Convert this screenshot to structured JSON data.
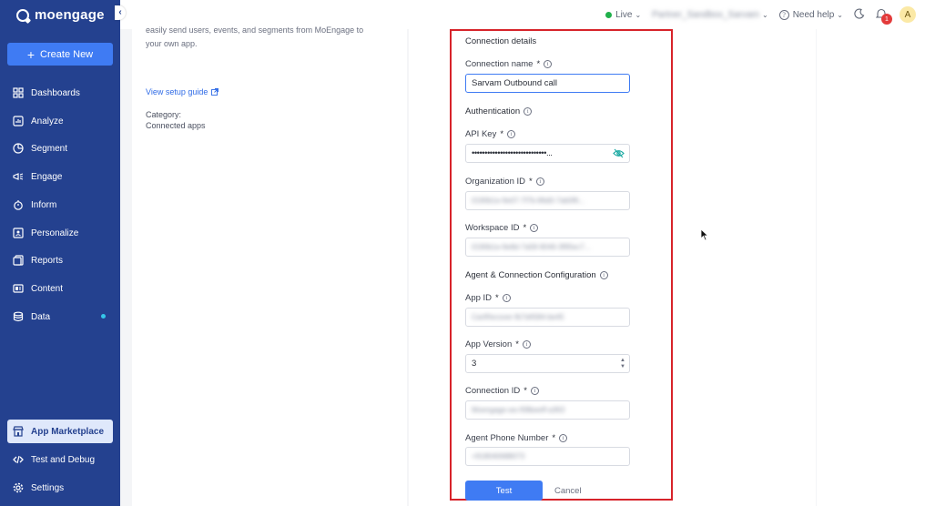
{
  "brand": {
    "name": "moengage"
  },
  "sidebar": {
    "create_label": "Create New",
    "items": [
      {
        "label": "Dashboards",
        "icon": "dashboard-icon"
      },
      {
        "label": "Analyze",
        "icon": "chart-icon"
      },
      {
        "label": "Segment",
        "icon": "pie-icon"
      },
      {
        "label": "Engage",
        "icon": "megaphone-icon"
      },
      {
        "label": "Inform",
        "icon": "bell-timer-icon"
      },
      {
        "label": "Personalize",
        "icon": "personalize-icon"
      },
      {
        "label": "Reports",
        "icon": "reports-icon"
      },
      {
        "label": "Content",
        "icon": "content-icon"
      },
      {
        "label": "Data",
        "icon": "database-icon"
      },
      {
        "label": "App Marketplace",
        "icon": "marketplace-icon"
      },
      {
        "label": "Test and Debug",
        "icon": "code-icon"
      },
      {
        "label": "Settings",
        "icon": "gear-icon"
      }
    ],
    "accent": "#24418f"
  },
  "topbar": {
    "env_label": "Live",
    "workspace_label": "Partner_Sandbox_Sarvam",
    "help_label": "Need help",
    "notification_count": "1",
    "avatar_initial": "A"
  },
  "info": {
    "line1": "easily send users, events, and segments from MoEngage to",
    "line2": "your own app.",
    "setup_link": "View setup guide",
    "category_label": "Category:",
    "category_value": "Connected apps"
  },
  "form": {
    "connection_details": "Connection details",
    "connection_name_label": "Connection name",
    "connection_name_value": "Sarvam Outbound call",
    "authentication": "Authentication",
    "api_key_label": "API Key",
    "api_key_value": "•••••••••••••••••••••••••••••...",
    "org_id_label": "Organization ID",
    "org_id_value": "0190b1e-9e07-7f7b-86d0-7ab0f6...",
    "workspace_id_label": "Workspace ID",
    "workspace_id_value": "0190b1e-9e8d-7a58-9046-3f95ec7...",
    "agent_config": "Agent & Connection Configuration",
    "app_id_label": "App ID",
    "app_id_value": "CartRecover-fb7d4584-be45",
    "app_version_label": "App Version",
    "app_version_value": "3",
    "connection_id_label": "Connection ID",
    "connection_id_value": "Moengage-ws-f08beeff-a363",
    "agent_phone_label": "Agent Phone Number",
    "agent_phone_value": "+918040688073",
    "test_label": "Test",
    "cancel_label": "Cancel",
    "highlight_color": "#d7232a",
    "primary_color": "#3f7bf3"
  }
}
